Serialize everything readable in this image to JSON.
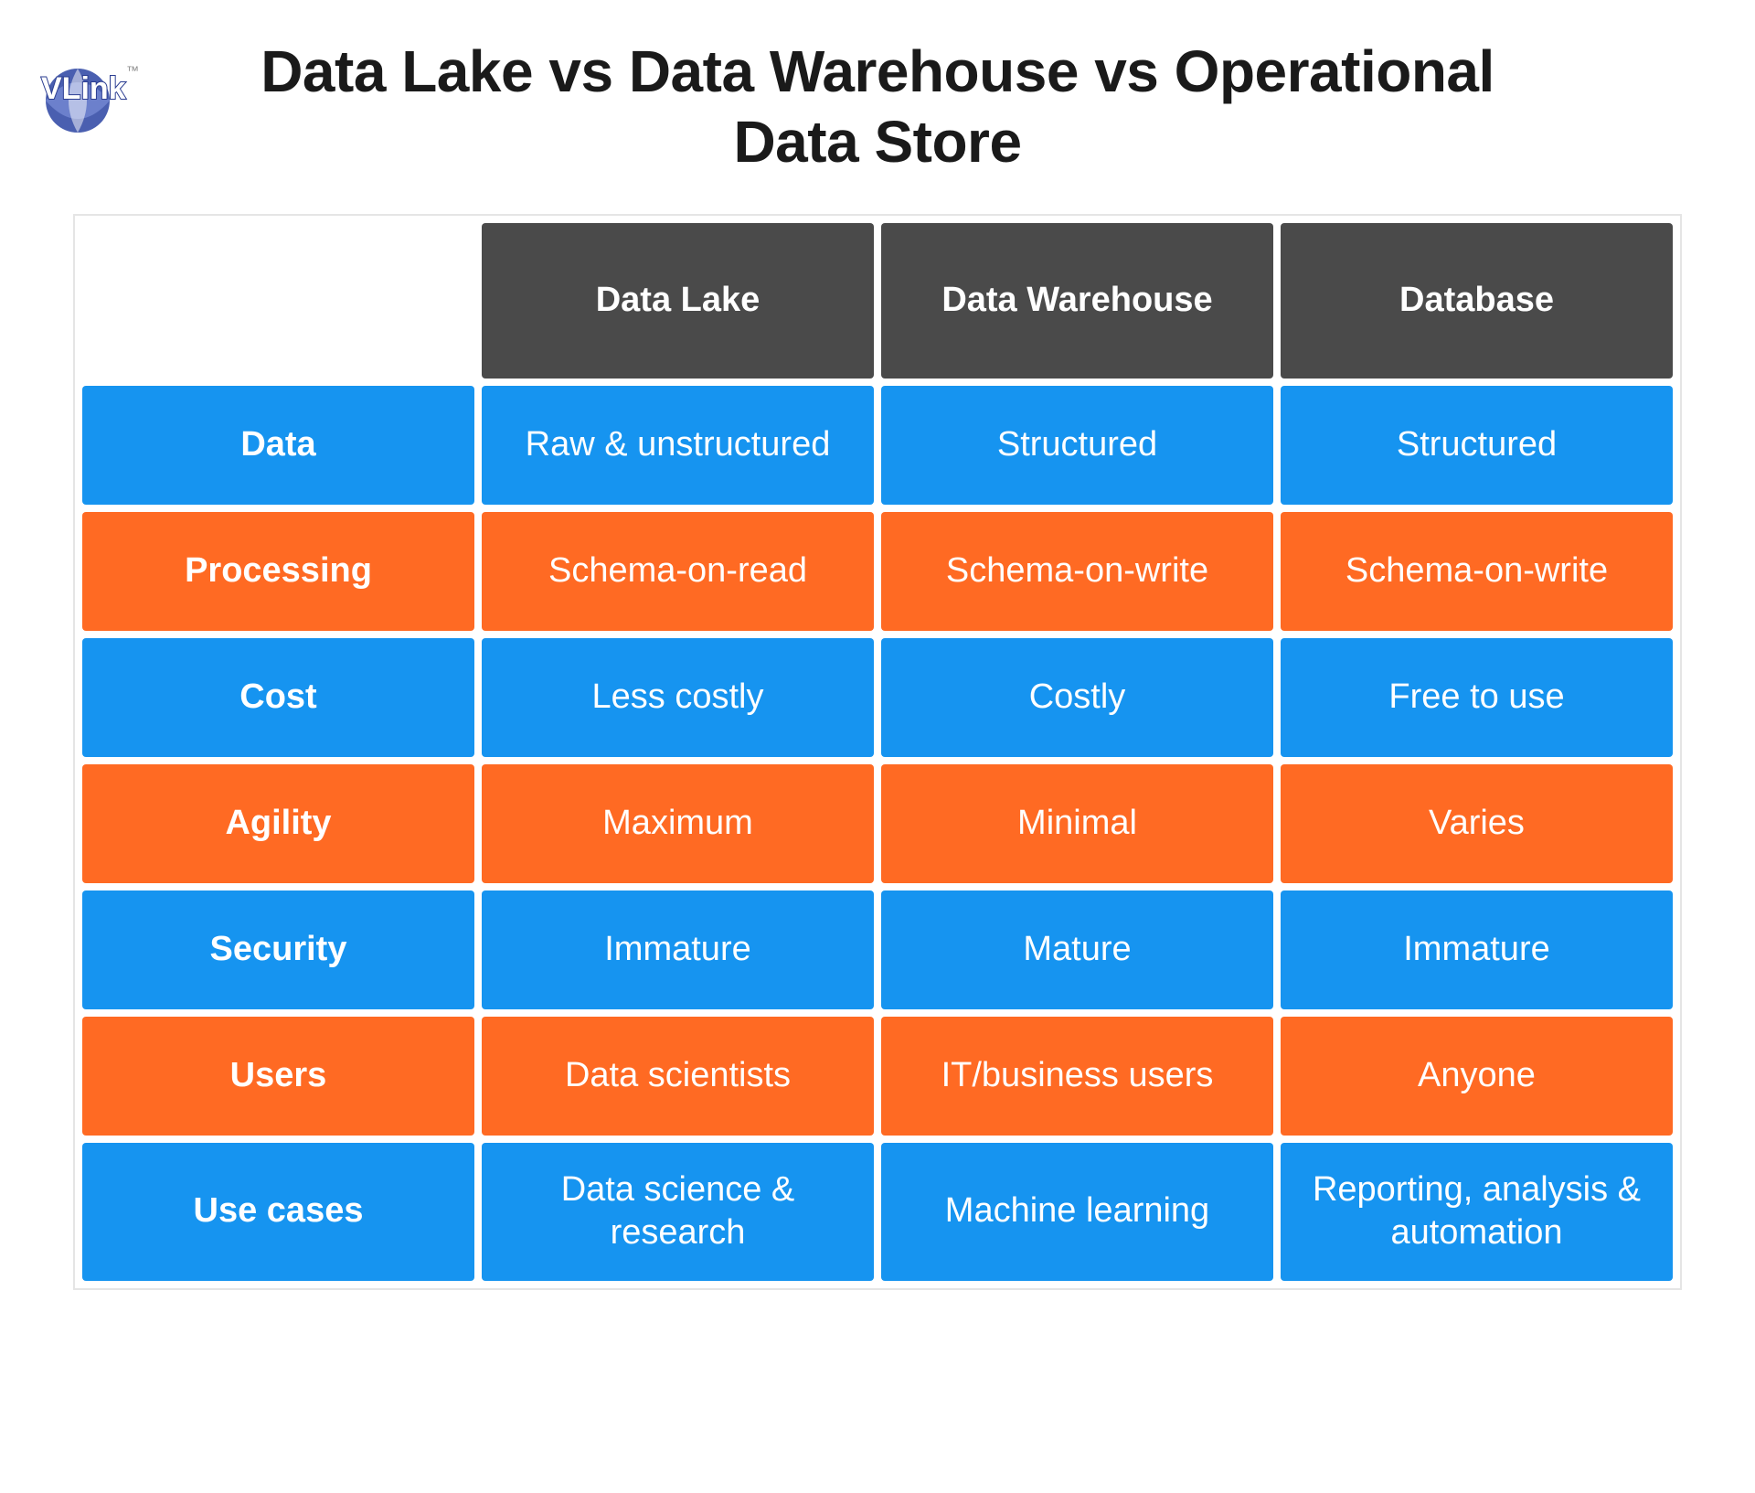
{
  "logo_text": "VLink",
  "title": "Data Lake vs Data Warehouse vs Operational Data Store",
  "chart_data": {
    "type": "table",
    "title": "Data Lake vs Data Warehouse vs Operational Data Store",
    "columns": [
      "",
      "Data Lake",
      "Data Warehouse",
      "Database"
    ],
    "rows": [
      {
        "label": "Data",
        "values": [
          "Raw & unstructured",
          "Structured",
          "Structured"
        ],
        "color": "blue"
      },
      {
        "label": "Processing",
        "values": [
          "Schema-on-read",
          "Schema-on-write",
          "Schema-on-write"
        ],
        "color": "orange"
      },
      {
        "label": "Cost",
        "values": [
          "Less costly",
          "Costly",
          "Free to use"
        ],
        "color": "blue"
      },
      {
        "label": "Agility",
        "values": [
          "Maximum",
          "Minimal",
          "Varies"
        ],
        "color": "orange"
      },
      {
        "label": "Security",
        "values": [
          "Immature",
          "Mature",
          "Immature"
        ],
        "color": "blue"
      },
      {
        "label": "Users",
        "values": [
          "Data scientists",
          "IT/business users",
          "Anyone"
        ],
        "color": "orange"
      },
      {
        "label": "Use cases",
        "values": [
          "Data science & research",
          "Machine learning",
          "Reporting, analysis &  automation"
        ],
        "color": "blue"
      }
    ]
  }
}
